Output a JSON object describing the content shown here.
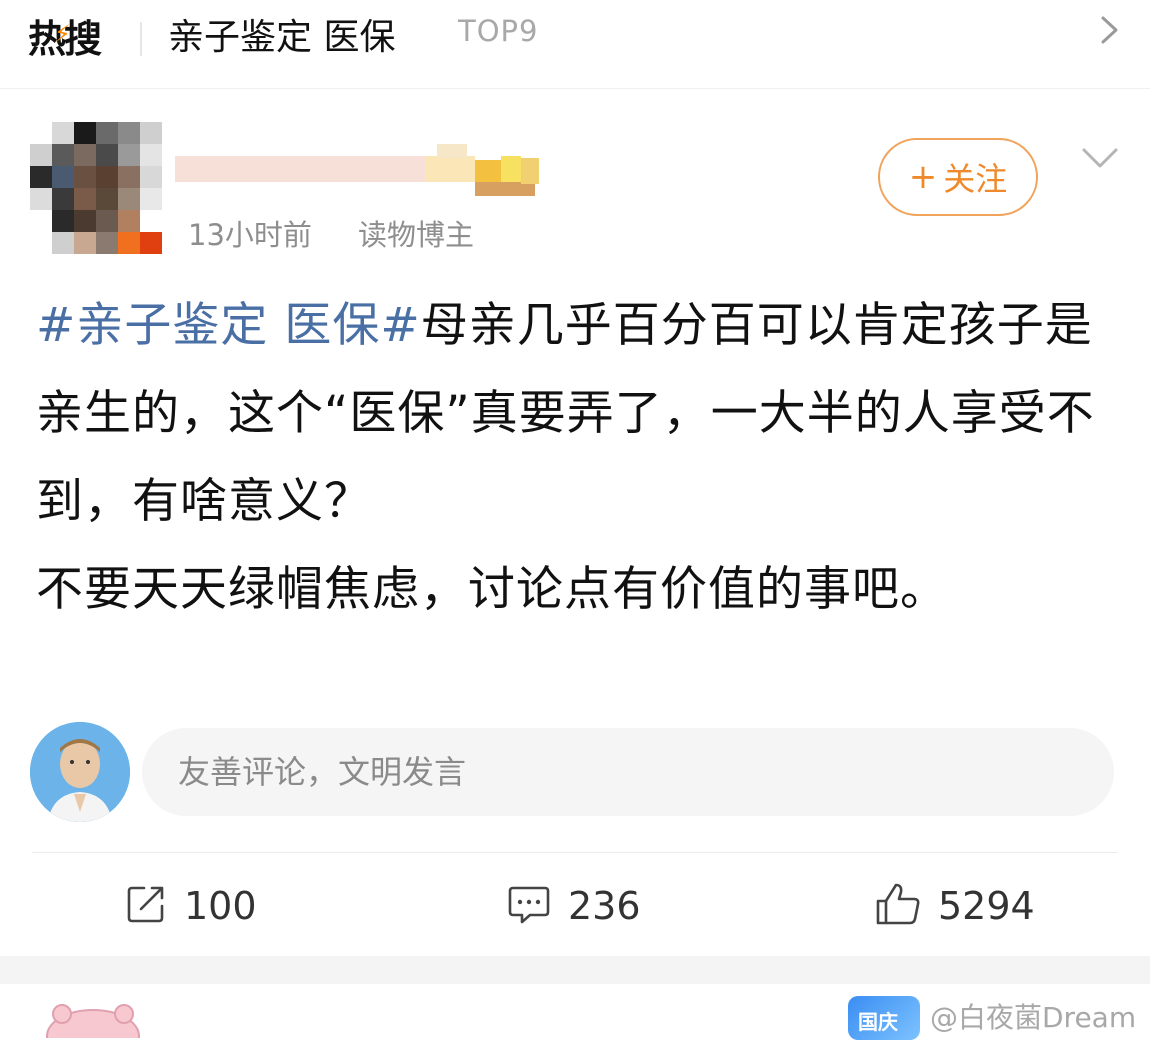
{
  "hot_search": {
    "logo_text": "热搜",
    "title": "亲子鉴定 医保",
    "rank": "TOP9"
  },
  "post": {
    "time": "13小时前",
    "author_tag": "读物博主",
    "follow_label": "关注",
    "topic": "#亲子鉴定 医保#",
    "text_part1": "母亲几乎百分百可以肯定孩子是亲生的，这个“医保”真要弄了，一大半的人享受不到，有啥意义？",
    "text_part2": "不要天天绿帽焦虑，讨论点有价值的事吧。"
  },
  "comment_box": {
    "placeholder": "友善评论，文明发言"
  },
  "actions": {
    "repost_count": "100",
    "comment_count": "236",
    "like_count": "5294"
  },
  "footer": {
    "promo_text": "国庆",
    "watermark": "@白夜菌Dream"
  },
  "colors": {
    "topic_blue": "#4a6fa5",
    "follow_orange": "#ef8a2c",
    "hot_flash": "#ff8a00"
  },
  "icons": {
    "hot_chevron": "chevron-right-icon",
    "more": "chevron-down-icon",
    "repost": "repost-icon",
    "comment": "comment-icon",
    "like": "thumbs-up-icon"
  }
}
